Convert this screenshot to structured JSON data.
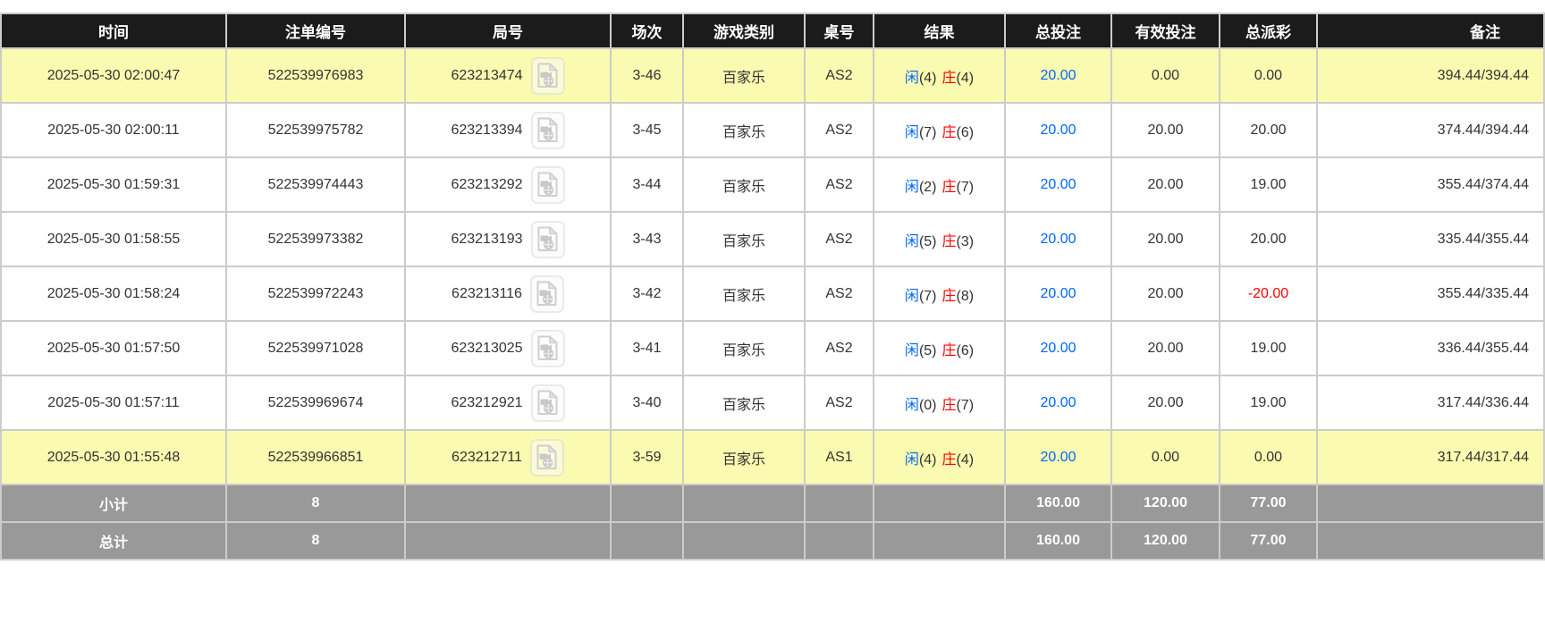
{
  "table": {
    "columns": [
      {
        "key": "time",
        "label": "时间"
      },
      {
        "key": "bet_id",
        "label": "注单编号"
      },
      {
        "key": "round_id",
        "label": "局号"
      },
      {
        "key": "session",
        "label": "场次"
      },
      {
        "key": "game_type",
        "label": "游戏类别"
      },
      {
        "key": "table_no",
        "label": "桌号"
      },
      {
        "key": "result",
        "label": "结果"
      },
      {
        "key": "total_bet",
        "label": "总投注"
      },
      {
        "key": "valid_bet",
        "label": "有效投注"
      },
      {
        "key": "payout",
        "label": "总派彩"
      },
      {
        "key": "remark",
        "label": "备注"
      }
    ],
    "rows": [
      {
        "time": "2025-05-30 02:00:47",
        "bet_id": "522539976983",
        "round_id": "623213474",
        "session": "3-46",
        "game_type": "百家乐",
        "table_no": "AS2",
        "result": {
          "player_label": "闲",
          "player_score": "(4)",
          "banker_label": "庄",
          "banker_score": "(4)"
        },
        "total_bet": "20.00",
        "valid_bet": "0.00",
        "payout": "0.00",
        "remark": "394.44/394.44",
        "highlight": true
      },
      {
        "time": "2025-05-30 02:00:11",
        "bet_id": "522539975782",
        "round_id": "623213394",
        "session": "3-45",
        "game_type": "百家乐",
        "table_no": "AS2",
        "result": {
          "player_label": "闲",
          "player_score": "(7)",
          "banker_label": "庄",
          "banker_score": "(6)"
        },
        "total_bet": "20.00",
        "valid_bet": "20.00",
        "payout": "20.00",
        "remark": "374.44/394.44",
        "highlight": false
      },
      {
        "time": "2025-05-30 01:59:31",
        "bet_id": "522539974443",
        "round_id": "623213292",
        "session": "3-44",
        "game_type": "百家乐",
        "table_no": "AS2",
        "result": {
          "player_label": "闲",
          "player_score": "(2)",
          "banker_label": "庄",
          "banker_score": "(7)"
        },
        "total_bet": "20.00",
        "valid_bet": "20.00",
        "payout": "19.00",
        "remark": "355.44/374.44",
        "highlight": false
      },
      {
        "time": "2025-05-30 01:58:55",
        "bet_id": "522539973382",
        "round_id": "623213193",
        "session": "3-43",
        "game_type": "百家乐",
        "table_no": "AS2",
        "result": {
          "player_label": "闲",
          "player_score": "(5)",
          "banker_label": "庄",
          "banker_score": "(3)"
        },
        "total_bet": "20.00",
        "valid_bet": "20.00",
        "payout": "20.00",
        "remark": "335.44/355.44",
        "highlight": false
      },
      {
        "time": "2025-05-30 01:58:24",
        "bet_id": "522539972243",
        "round_id": "623213116",
        "session": "3-42",
        "game_type": "百家乐",
        "table_no": "AS2",
        "result": {
          "player_label": "闲",
          "player_score": "(7)",
          "banker_label": "庄",
          "banker_score": "(8)"
        },
        "total_bet": "20.00",
        "valid_bet": "20.00",
        "payout": "-20.00",
        "remark": "355.44/335.44",
        "highlight": false
      },
      {
        "time": "2025-05-30 01:57:50",
        "bet_id": "522539971028",
        "round_id": "623213025",
        "session": "3-41",
        "game_type": "百家乐",
        "table_no": "AS2",
        "result": {
          "player_label": "闲",
          "player_score": "(5)",
          "banker_label": "庄",
          "banker_score": "(6)"
        },
        "total_bet": "20.00",
        "valid_bet": "20.00",
        "payout": "19.00",
        "remark": "336.44/355.44",
        "highlight": false
      },
      {
        "time": "2025-05-30 01:57:11",
        "bet_id": "522539969674",
        "round_id": "623212921",
        "session": "3-40",
        "game_type": "百家乐",
        "table_no": "AS2",
        "result": {
          "player_label": "闲",
          "player_score": "(0)",
          "banker_label": "庄",
          "banker_score": "(7)"
        },
        "total_bet": "20.00",
        "valid_bet": "20.00",
        "payout": "19.00",
        "remark": "317.44/336.44",
        "highlight": false
      },
      {
        "time": "2025-05-30 01:55:48",
        "bet_id": "522539966851",
        "round_id": "623212711",
        "session": "3-59",
        "game_type": "百家乐",
        "table_no": "AS1",
        "result": {
          "player_label": "闲",
          "player_score": "(4)",
          "banker_label": "庄",
          "banker_score": "(4)"
        },
        "total_bet": "20.00",
        "valid_bet": "0.00",
        "payout": "0.00",
        "remark": "317.44/317.44",
        "highlight": true
      }
    ],
    "footer": [
      {
        "label": "小计",
        "count": "8",
        "total_bet": "160.00",
        "valid_bet": "120.00",
        "payout": "77.00"
      },
      {
        "label": "总计",
        "count": "8",
        "total_bet": "160.00",
        "valid_bet": "120.00",
        "payout": "77.00"
      }
    ]
  },
  "icons": {
    "round_video": "video-replay-icon"
  },
  "colors": {
    "header_bg": "#1b1b1b",
    "highlight_row": "#fafab0",
    "player_blue": "#0066ff",
    "banker_red": "#ff0000",
    "negative_red": "#ff0000",
    "total_bet_blue": "#0066ff",
    "footer_bg": "#999999",
    "grid_line": "#cccccc"
  }
}
